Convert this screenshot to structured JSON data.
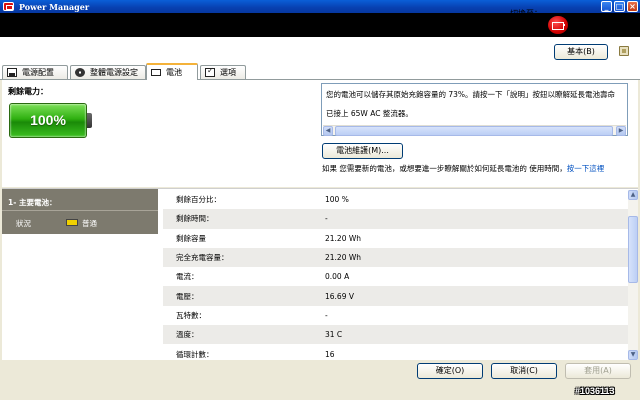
{
  "window": {
    "title": "Power Manager",
    "controls": {
      "minimize": "_",
      "maximize": "□",
      "close": "×"
    }
  },
  "icons": {
    "app": "power-manager-icon",
    "banner": "battery-plug-icon",
    "help": "help-book-icon"
  },
  "switch": {
    "label": "切換至：",
    "button_label": "基本(B)"
  },
  "tabs": [
    {
      "label": "電源配置",
      "icon": "power-plan-icon"
    },
    {
      "label": "整體電源設定",
      "icon": "gear-icon"
    },
    {
      "label": "電池",
      "icon": "battery-icon",
      "active": true
    },
    {
      "label": "選項",
      "icon": "checkbox-icon"
    }
  ],
  "battery_summary": {
    "label": "剩餘電力：",
    "percent_text": "100%",
    "fill_level": 1.0,
    "color": "#2fb010"
  },
  "message": {
    "line1": "您的電池可以儲存其原始充飽容量的 73%。請按一下「說明」按鈕以瞭解延長電池壽命",
    "line2": "已接上 65W AC 整流器。"
  },
  "maintenance_button": "電池維護(M)...",
  "hint": {
    "text": "如果 您需要新的電池，或想要進一步瞭解關於如何延長電池的 使用時間，",
    "link": "按一下這裡"
  },
  "battery_panel": {
    "header": "1- 主要電池：",
    "status_label": "狀況",
    "status_value": "普通"
  },
  "details": [
    {
      "key": "剩餘百分比：",
      "value": "100 %"
    },
    {
      "key": "剩餘時間：",
      "value": "-"
    },
    {
      "key": "剩餘容量",
      "value": "21.20 Wh"
    },
    {
      "key": "完全充電容量：",
      "value": "21.20 Wh"
    },
    {
      "key": "電流：",
      "value": "0.00 A"
    },
    {
      "key": "電壓：",
      "value": "16.69 V"
    },
    {
      "key": "瓦特數：",
      "value": "-"
    },
    {
      "key": "溫度：",
      "value": "31 C"
    },
    {
      "key": "循環計數：",
      "value": "16"
    }
  ],
  "footer": {
    "ok": "確定(O)",
    "cancel": "取消(C)",
    "apply": "套用(A)"
  },
  "watermark": "#1036113"
}
